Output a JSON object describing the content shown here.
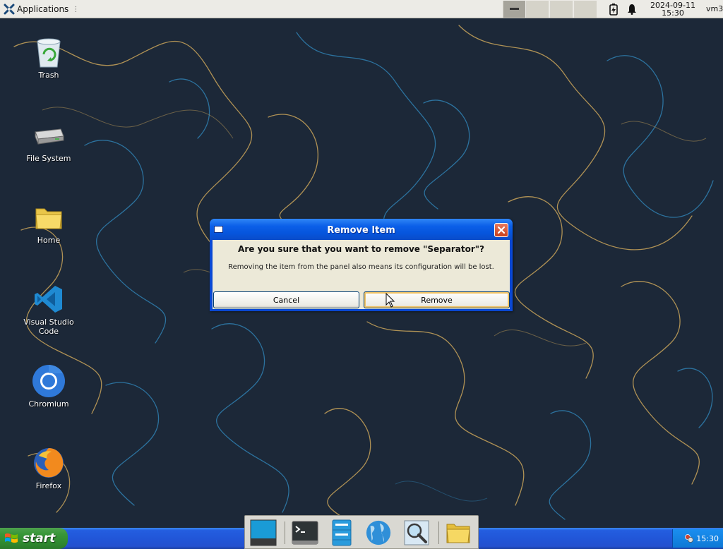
{
  "top_panel": {
    "apps_label": "Applications",
    "clock_date": "2024-09-11",
    "clock_time": "15:30",
    "user": "vm3"
  },
  "desktop": {
    "icons": [
      {
        "label": "Trash",
        "icon": "trash-icon"
      },
      {
        "label": "File System",
        "icon": "hard-drive-icon"
      },
      {
        "label": "Home",
        "icon": "folder-icon"
      },
      {
        "label": "Visual Studio Code",
        "icon": "vscode-icon"
      },
      {
        "label": "Chromium",
        "icon": "chromium-icon"
      },
      {
        "label": "Firefox",
        "icon": "firefox-icon"
      }
    ]
  },
  "dialog": {
    "title": "Remove Item",
    "heading": "Are you sure that you want to remove \"Separator\"?",
    "message": "Removing the item from the panel also means its configuration will be lost.",
    "cancel_label": "Cancel",
    "remove_label": "Remove"
  },
  "taskbar": {
    "start_label": "start",
    "tray_time": "15:30",
    "dock_items": [
      "show-desktop-icon",
      "terminal-icon",
      "files-icon",
      "browser-globe-icon",
      "search-icon",
      "folder-icon"
    ]
  },
  "colors": {
    "titlebar_blue": "#0b5fe8",
    "dialog_bg": "#ece9d8",
    "taskbar_blue": "#245ee0",
    "start_green": "#389638",
    "wallpaper": "#1c2838"
  }
}
